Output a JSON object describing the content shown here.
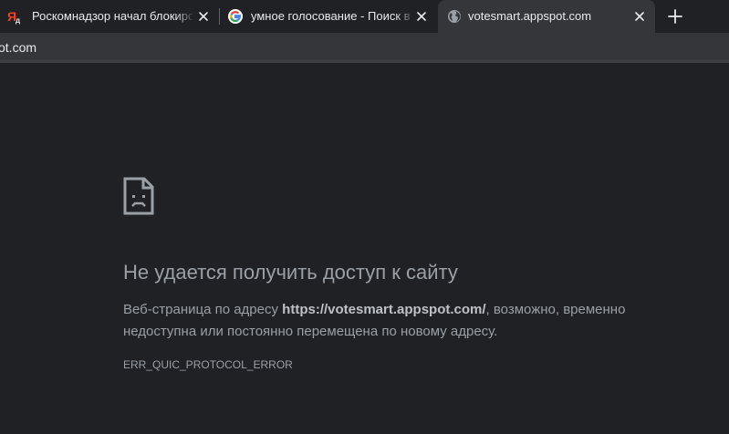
{
  "tabs": [
    {
      "title": "Роскомнадзор начал блокировать",
      "icon": "yandex-icon",
      "active": false
    },
    {
      "title": "умное голосование - Поиск в Google",
      "icon": "google-icon",
      "active": false
    },
    {
      "title": "votesmart.appspot.com",
      "icon": "globe-icon",
      "active": true
    }
  ],
  "omnibox": {
    "url": "ot.com"
  },
  "error": {
    "heading": "Не удается получить доступ к сайту",
    "desc_prefix": "Веб-страница по адресу ",
    "desc_url": "https://votesmart.appspot.com/",
    "desc_suffix": ", возможно, временно недоступна или постоянно перемещена по новому адресу.",
    "code": "ERR_QUIC_PROTOCOL_ERROR"
  },
  "colors": {
    "background": "#202124",
    "toolbar": "#35363a",
    "text": "#9aa0a6",
    "tab_text": "#e8eaed",
    "yandex_red": "#fc3f1d"
  }
}
